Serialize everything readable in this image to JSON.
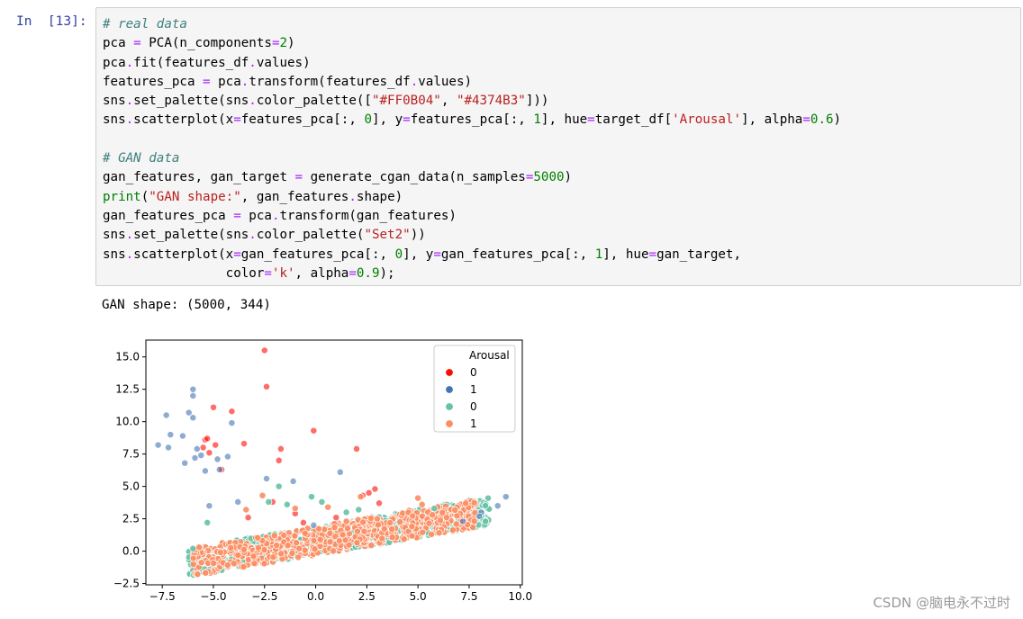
{
  "cell": {
    "prompt": "In  [13]:",
    "lines": [
      [
        {
          "t": "# real data",
          "c": "c-comment"
        }
      ],
      [
        {
          "t": "pca "
        },
        {
          "t": "=",
          "c": "c-op"
        },
        {
          "t": " PCA(n_components"
        },
        {
          "t": "=",
          "c": "c-op"
        },
        {
          "t": "2",
          "c": "c-num"
        },
        {
          "t": ")"
        }
      ],
      [
        {
          "t": "pca"
        },
        {
          "t": ".",
          "c": "c-op"
        },
        {
          "t": "fit(features_df"
        },
        {
          "t": ".",
          "c": "c-op"
        },
        {
          "t": "values)"
        }
      ],
      [
        {
          "t": "features_pca "
        },
        {
          "t": "=",
          "c": "c-op"
        },
        {
          "t": " pca"
        },
        {
          "t": ".",
          "c": "c-op"
        },
        {
          "t": "transform(features_df"
        },
        {
          "t": ".",
          "c": "c-op"
        },
        {
          "t": "values)"
        }
      ],
      [
        {
          "t": "sns"
        },
        {
          "t": ".",
          "c": "c-op"
        },
        {
          "t": "set_palette(sns"
        },
        {
          "t": ".",
          "c": "c-op"
        },
        {
          "t": "color_palette(["
        },
        {
          "t": "\"#FF0B04\"",
          "c": "c-str"
        },
        {
          "t": ", "
        },
        {
          "t": "\"#4374B3\"",
          "c": "c-str"
        },
        {
          "t": "]))"
        }
      ],
      [
        {
          "t": "sns"
        },
        {
          "t": ".",
          "c": "c-op"
        },
        {
          "t": "scatterplot(x"
        },
        {
          "t": "=",
          "c": "c-op"
        },
        {
          "t": "features_pca[:, "
        },
        {
          "t": "0",
          "c": "c-num"
        },
        {
          "t": "], y"
        },
        {
          "t": "=",
          "c": "c-op"
        },
        {
          "t": "features_pca[:, "
        },
        {
          "t": "1",
          "c": "c-num"
        },
        {
          "t": "], hue"
        },
        {
          "t": "=",
          "c": "c-op"
        },
        {
          "t": "target_df["
        },
        {
          "t": "'Arousal'",
          "c": "c-str"
        },
        {
          "t": "], alpha"
        },
        {
          "t": "=",
          "c": "c-op"
        },
        {
          "t": "0.6",
          "c": "c-num"
        },
        {
          "t": ")"
        }
      ],
      [
        {
          "t": ""
        }
      ],
      [
        {
          "t": "# GAN data",
          "c": "c-comment"
        }
      ],
      [
        {
          "t": "gan_features, gan_target "
        },
        {
          "t": "=",
          "c": "c-op"
        },
        {
          "t": " generate_cgan_data(n_samples"
        },
        {
          "t": "=",
          "c": "c-op"
        },
        {
          "t": "5000",
          "c": "c-num"
        },
        {
          "t": ")"
        }
      ],
      [
        {
          "t": "print",
          "c": "c-builtin"
        },
        {
          "t": "("
        },
        {
          "t": "\"GAN shape:\"",
          "c": "c-str"
        },
        {
          "t": ", gan_features"
        },
        {
          "t": ".",
          "c": "c-op"
        },
        {
          "t": "shape)"
        }
      ],
      [
        {
          "t": "gan_features_pca "
        },
        {
          "t": "=",
          "c": "c-op"
        },
        {
          "t": " pca"
        },
        {
          "t": ".",
          "c": "c-op"
        },
        {
          "t": "transform(gan_features)"
        }
      ],
      [
        {
          "t": "sns"
        },
        {
          "t": ".",
          "c": "c-op"
        },
        {
          "t": "set_palette(sns"
        },
        {
          "t": ".",
          "c": "c-op"
        },
        {
          "t": "color_palette("
        },
        {
          "t": "\"Set2\"",
          "c": "c-str"
        },
        {
          "t": "))"
        }
      ],
      [
        {
          "t": "sns"
        },
        {
          "t": ".",
          "c": "c-op"
        },
        {
          "t": "scatterplot(x"
        },
        {
          "t": "=",
          "c": "c-op"
        },
        {
          "t": "gan_features_pca[:, "
        },
        {
          "t": "0",
          "c": "c-num"
        },
        {
          "t": "], y"
        },
        {
          "t": "=",
          "c": "c-op"
        },
        {
          "t": "gan_features_pca[:, "
        },
        {
          "t": "1",
          "c": "c-num"
        },
        {
          "t": "], hue"
        },
        {
          "t": "=",
          "c": "c-op"
        },
        {
          "t": "gan_target,"
        }
      ],
      [
        {
          "t": "                color"
        },
        {
          "t": "=",
          "c": "c-op"
        },
        {
          "t": "'k'",
          "c": "c-str"
        },
        {
          "t": ", alpha"
        },
        {
          "t": "=",
          "c": "c-op"
        },
        {
          "t": "0.9",
          "c": "c-num"
        },
        {
          "t": ");"
        }
      ]
    ]
  },
  "output": {
    "stdout": "GAN shape: (5000, 344)"
  },
  "watermark": "CSDN @脑电永不过时",
  "chart_data": {
    "type": "scatter",
    "xlim": [
      -8.3,
      10.1
    ],
    "ylim": [
      -2.6,
      16.3
    ],
    "xticks": [
      "−7.5",
      "−5.0",
      "−2.5",
      "0.0",
      "2.5",
      "5.0",
      "7.5",
      "10.0"
    ],
    "xtick_values": [
      -7.5,
      -5.0,
      -2.5,
      0.0,
      2.5,
      5.0,
      7.5,
      10.0
    ],
    "yticks": [
      "−2.5",
      "0.0",
      "2.5",
      "5.0",
      "7.5",
      "10.0",
      "12.5",
      "15.0"
    ],
    "ytick_values": [
      -2.5,
      0.0,
      2.5,
      5.0,
      7.5,
      10.0,
      12.5,
      15.0
    ],
    "grid": false,
    "legend": {
      "title": "Arousal",
      "placement": "top-right",
      "entries": [
        {
          "label": "0",
          "color": "#FF0B04"
        },
        {
          "label": "1",
          "color": "#4374B3"
        },
        {
          "label": "0",
          "color": "#66c2a5"
        },
        {
          "label": "1",
          "color": "#fc8d62"
        }
      ]
    },
    "series": [
      {
        "name": "0",
        "color": "#FF0B04",
        "alpha": 0.6,
        "points": [
          [
            -2.5,
            15.5
          ],
          [
            -2.4,
            12.7
          ],
          [
            -5.0,
            11.1
          ],
          [
            -4.1,
            10.8
          ],
          [
            -5.4,
            8.6
          ],
          [
            -5.3,
            8.7
          ],
          [
            -4.9,
            8.2
          ],
          [
            -5.5,
            8.0
          ],
          [
            -3.5,
            8.3
          ],
          [
            -5.2,
            7.6
          ],
          [
            -4.6,
            6.3
          ],
          [
            -1.7,
            7.9
          ],
          [
            -0.1,
            9.3
          ],
          [
            2.0,
            7.9
          ],
          [
            -1.8,
            7.0
          ],
          [
            2.3,
            4.3
          ],
          [
            2.6,
            4.5
          ],
          [
            2.9,
            4.8
          ],
          [
            -2.1,
            3.8
          ],
          [
            -1.0,
            2.9
          ],
          [
            -3.3,
            2.6
          ],
          [
            3.1,
            3.7
          ],
          [
            -0.6,
            2.2
          ],
          [
            1.0,
            2.6
          ]
        ]
      },
      {
        "name": "1",
        "color": "#4374B3",
        "alpha": 0.6,
        "points": [
          [
            -6.0,
            12.5
          ],
          [
            -6.0,
            12.0
          ],
          [
            -7.3,
            10.5
          ],
          [
            -6.2,
            10.7
          ],
          [
            -4.1,
            9.9
          ],
          [
            -6.0,
            10.3
          ],
          [
            -7.1,
            9.0
          ],
          [
            -6.5,
            8.9
          ],
          [
            -7.7,
            8.2
          ],
          [
            -7.2,
            8.0
          ],
          [
            -5.8,
            7.9
          ],
          [
            -5.9,
            7.2
          ],
          [
            -5.6,
            7.4
          ],
          [
            -6.4,
            6.8
          ],
          [
            -5.4,
            6.2
          ],
          [
            -4.7,
            6.3
          ],
          [
            -4.8,
            7.1
          ],
          [
            -4.3,
            7.3
          ],
          [
            -2.4,
            5.6
          ],
          [
            -1.1,
            5.4
          ],
          [
            1.2,
            6.1
          ],
          [
            -5.2,
            3.5
          ],
          [
            -3.8,
            3.8
          ],
          [
            8.9,
            3.5
          ],
          [
            9.3,
            4.2
          ],
          [
            8.1,
            3.0
          ],
          [
            8.0,
            2.7
          ],
          [
            7.2,
            2.3
          ],
          [
            -0.1,
            2.0
          ]
        ]
      },
      {
        "name": "0",
        "color": "#66c2a5",
        "alpha": 0.9,
        "cloud": {
          "x_range": [
            -6.2,
            8.5
          ],
          "count": 620,
          "seed": 11
        },
        "points": [
          [
            -2.3,
            3.8
          ],
          [
            -0.2,
            4.2
          ],
          [
            -1.8,
            5.0
          ],
          [
            2.1,
            3.2
          ],
          [
            1.5,
            3.0
          ],
          [
            -5.3,
            2.2
          ],
          [
            -6.0,
            0.2
          ],
          [
            8.3,
            2.3
          ],
          [
            5.8,
            3.3
          ],
          [
            -1.4,
            3.6
          ],
          [
            0.3,
            3.8
          ]
        ]
      },
      {
        "name": "1",
        "color": "#fc8d62",
        "alpha": 0.9,
        "cloud": {
          "x_range": [
            -6.0,
            7.8
          ],
          "count": 650,
          "seed": 29
        },
        "points": [
          [
            -2.6,
            4.3
          ],
          [
            -1.0,
            3.3
          ],
          [
            0.6,
            3.4
          ],
          [
            2.2,
            4.2
          ],
          [
            -3.4,
            3.2
          ],
          [
            5.0,
            4.1
          ],
          [
            5.2,
            3.6
          ],
          [
            -5.7,
            0.3
          ],
          [
            6.4,
            2.6
          ]
        ]
      }
    ]
  }
}
